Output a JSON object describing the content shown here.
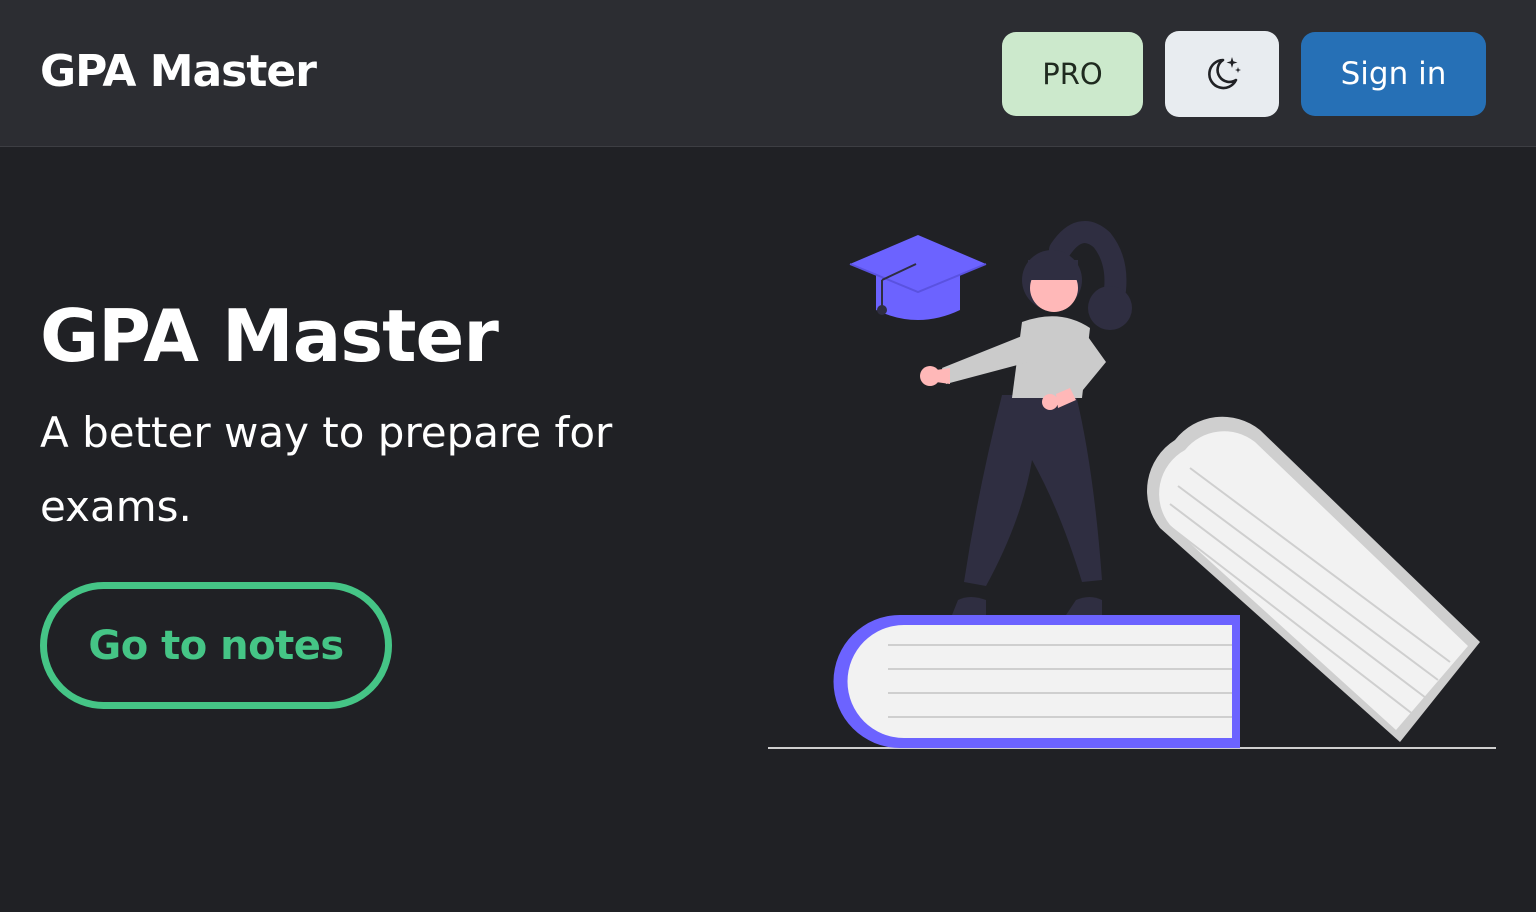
{
  "header": {
    "brand": "GPA Master",
    "pro_label": "PRO",
    "theme_icon": "moon-stars-icon",
    "signin_label": "Sign in"
  },
  "hero": {
    "title": "GPA Master",
    "subtitle": "A better way to prepare for exams.",
    "cta_label": "Go to notes",
    "illustration": "student-with-books-and-graduation-cap"
  },
  "colors": {
    "page_background": "#202125",
    "header_background": "#2c2d32",
    "pro_button": "#cce9cc",
    "theme_button": "#e8ecf0",
    "signin_button": "#2670b6",
    "cta_accent": "#45c586",
    "illustration_accent": "#6c63ff"
  }
}
